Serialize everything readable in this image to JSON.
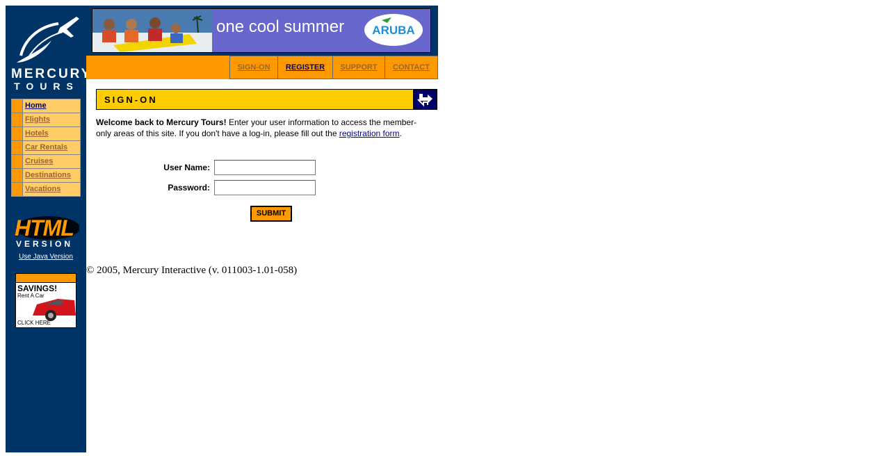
{
  "logo": {
    "line1": "MERCURY",
    "line2": "TOURS"
  },
  "sidebar": {
    "items": [
      {
        "label": "Home",
        "active": true
      },
      {
        "label": "Flights"
      },
      {
        "label": "Hotels"
      },
      {
        "label": "Car Rentals"
      },
      {
        "label": "Cruises"
      },
      {
        "label": "Destinations"
      },
      {
        "label": "Vacations"
      }
    ],
    "html_badge": {
      "line1": "HTML",
      "line2": "VERSION"
    },
    "java_link": "Use Java Version",
    "ad": {
      "headline": "SAVINGS!",
      "sub": "Rent A Car",
      "cta": "CLICK HERE"
    }
  },
  "banner": {
    "tagline": "one cool summer",
    "brand": "ARUBA"
  },
  "topnav": {
    "signon": "SIGN-ON",
    "register": "REGISTER",
    "support": "SUPPORT",
    "contact": "CONTACT"
  },
  "signon": {
    "title": "SIGN-ON",
    "welcome_bold": "Welcome back to Mercury Tours!",
    "welcome_rest": " Enter your user information to access the member-only areas of this site. If you don't have a log-in, please fill out the ",
    "registration_link": "registration form",
    "period": ".",
    "username_label": "User Name:",
    "username_value": "",
    "password_label": "Password:",
    "password_value": "",
    "submit_label": "SUBMIT"
  },
  "footer": {
    "copyright": "© 2005, Mercury Interactive (v. 011003-1.01-058)"
  },
  "colors": {
    "navy": "#003366",
    "orange": "#ff9900",
    "yellow": "#ffcc00",
    "banner_purple": "#6666cc"
  }
}
